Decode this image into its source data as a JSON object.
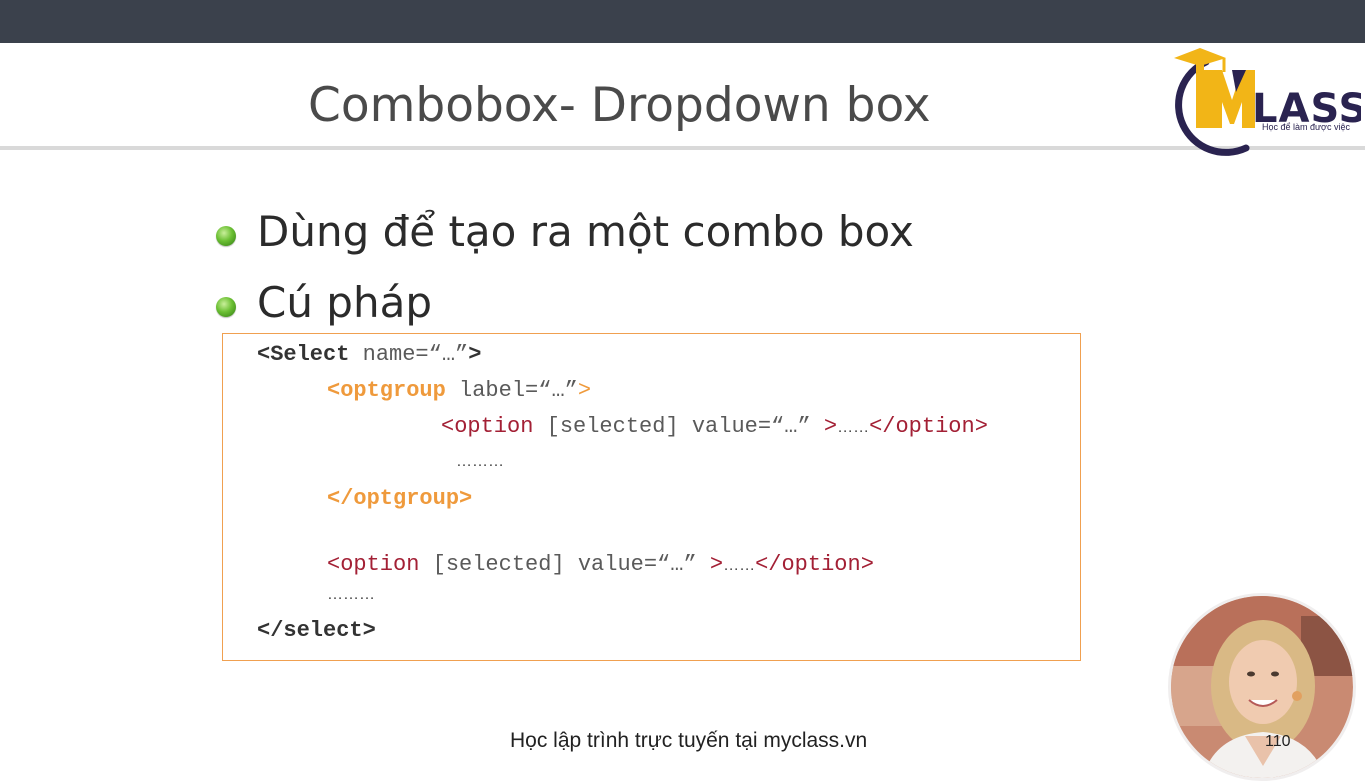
{
  "slide": {
    "title": "Combobox- Dropdown box",
    "bullets": [
      "Dùng để tạo ra một combo box",
      "Cú pháp"
    ],
    "footer": "Học lập trình trực tuyến tại myclass.vn",
    "page_number": "110"
  },
  "logo": {
    "text": "LASS",
    "tagline": "Học để làm được việc"
  },
  "code": {
    "line1": {
      "tag": "<Select",
      "attr": " name=“…”",
      "close": ">"
    },
    "line2": {
      "tag": "<optgroup",
      "attr": " label=“…”",
      "close": ">"
    },
    "line3": {
      "open": "<option",
      "attr": " [selected] value=“…” ",
      "close": ">",
      "dots": "……",
      "end": "</option>"
    },
    "line4": "………",
    "line5": "</optgroup>",
    "line6": {
      "open": "<option",
      "attr": " [selected] value=“…” ",
      "close": ">",
      "dots": "……",
      "end": "</option>"
    },
    "line7": "………",
    "line8": "</select>"
  },
  "colors": {
    "topbar": "#3b414c",
    "accent_orange": "#ef9a3c",
    "code_red": "#a32035",
    "bullet_green": "#6cc034"
  }
}
